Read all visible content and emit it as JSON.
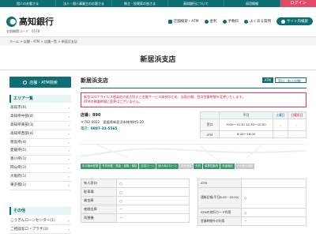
{
  "topnav": {
    "items": [
      "個人のお客さま",
      "法人・個人事業主のお客さま",
      "株主・投資家の皆さま",
      "高知銀行について",
      "採用情報"
    ],
    "login": "ログイン"
  },
  "header": {
    "logo_text": "高知銀行",
    "bank_code": "金融機関コード：0578",
    "nav": {
      "store_search": "店舗検索・ATM",
      "rates": "金利",
      "fees": "手数料",
      "faq": "よくある質問",
      "sitemap": "サイト内検索"
    }
  },
  "breadcrumb": "ホーム > 店舗・ATM > 店舗一覧 > 新居浜支店",
  "page_title": "新居浜支店",
  "sidebar": {
    "store_search_button": "店舗・ATM検索",
    "area_heading": "エリア一覧",
    "areas": [
      {
        "label": "高知市(9)"
      },
      {
        "label": "高知県中部(4)"
      },
      {
        "label": "高知県東部(3)"
      },
      {
        "label": "高知県西部(4)"
      },
      {
        "label": "徳島県(4)"
      },
      {
        "label": "愛媛県(5)"
      },
      {
        "label": "香川県(1)"
      },
      {
        "label": "岡山県(1)"
      },
      {
        "label": "大阪府(1)"
      },
      {
        "label": "東京都(1)"
      }
    ],
    "other_heading": "その他",
    "others": [
      {
        "label": "こうぎんローンセンター(1)"
      },
      {
        "label": "ご相談窓口・プラザ(3)"
      }
    ]
  },
  "main": {
    "branch_name": "新居浜支店",
    "tags": {
      "atm": "ATM",
      "type": "窓口（有人店舗）"
    },
    "notice_line1": "新型コロナウイルス感染症の拡大防止と金融サービス維持のため、当面の間、窓口営業時間を変更いたします。",
    "notice_line2": "ATMの稼働時間に変更はございません。",
    "store_no": "店番：890",
    "address": "〒792-0022　愛媛県新居浜市徳常町5-20",
    "phone": "0897-33-5565",
    "phone_prefix": "電話：",
    "hours": {
      "headers": [
        "",
        "平日",
        "土曜日",
        "日曜祝日"
      ],
      "rows": [
        {
          "label": "窓口",
          "weekday": "9:00～11:30 12:30～15:00",
          "sat": "-",
          "sun": "-"
        },
        {
          "label": "ATM",
          "weekday": "8:45～18:00",
          "sat": "-",
          "sun": "-"
        }
      ]
    },
    "services": [
      {
        "label": "年中無休営業",
        "on": true
      },
      {
        "label": "外貨両替・預金・保険・相談",
        "on": true
      },
      {
        "label": "住宅ローン",
        "on": true
      },
      {
        "label": "個人向けローン",
        "on": true
      },
      {
        "label": "投資信託",
        "on": false
      },
      {
        "label": "外貨",
        "on": true
      },
      {
        "label": "事業性融資",
        "on": true
      },
      {
        "label": "年金相談",
        "on": true
      },
      {
        "label": "その他の相談",
        "on": false
      }
    ],
    "info_left": [
      {
        "k": "有人窓口",
        "v": "○"
      },
      {
        "k": "駐車場",
        "v": "○"
      },
      {
        "k": "貸金庫",
        "v": "○"
      },
      {
        "k": "夜間金庫",
        "v": "－"
      },
      {
        "k": "両替機",
        "v": "－"
      }
    ],
    "info_right": [
      {
        "k": "ATM",
        "v": ""
      },
      {
        "k": "通帳記帳(平日8:45~18:00)",
        "v": "○"
      },
      {
        "k": "ATMの他行カード利用",
        "v": "○"
      },
      {
        "k": "営業時間外の利用",
        "v": "－"
      }
    ]
  },
  "colors": {
    "brand": "#0f6e74",
    "login": "#e04b6a",
    "notice": "#d51e3a",
    "service_on": "#3a9a6a",
    "service_off": "#c8c8c8"
  }
}
